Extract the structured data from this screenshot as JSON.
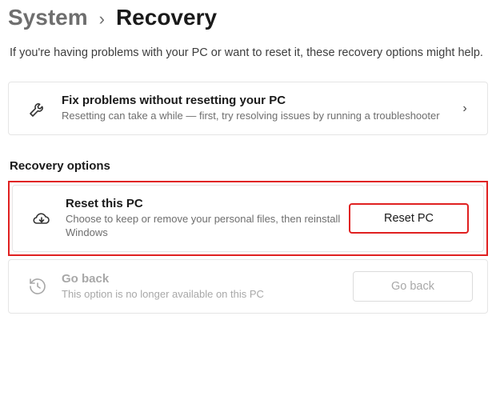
{
  "breadcrumb": {
    "parent": "System",
    "separator": "›",
    "current": "Recovery"
  },
  "intro": "If you're having problems with your PC or want to reset it, these recovery options might help.",
  "fix_card": {
    "icon": "wrench-icon",
    "title": "Fix problems without resetting your PC",
    "desc": "Resetting can take a while — first, try resolving issues by running a troubleshooter"
  },
  "section_title": "Recovery options",
  "reset_card": {
    "icon": "cloud-download-icon",
    "title": "Reset this PC",
    "desc": "Choose to keep or remove your personal files, then reinstall Windows",
    "button": "Reset PC"
  },
  "goback_card": {
    "icon": "history-icon",
    "title": "Go back",
    "desc": "This option is no longer available on this PC",
    "button": "Go back"
  }
}
